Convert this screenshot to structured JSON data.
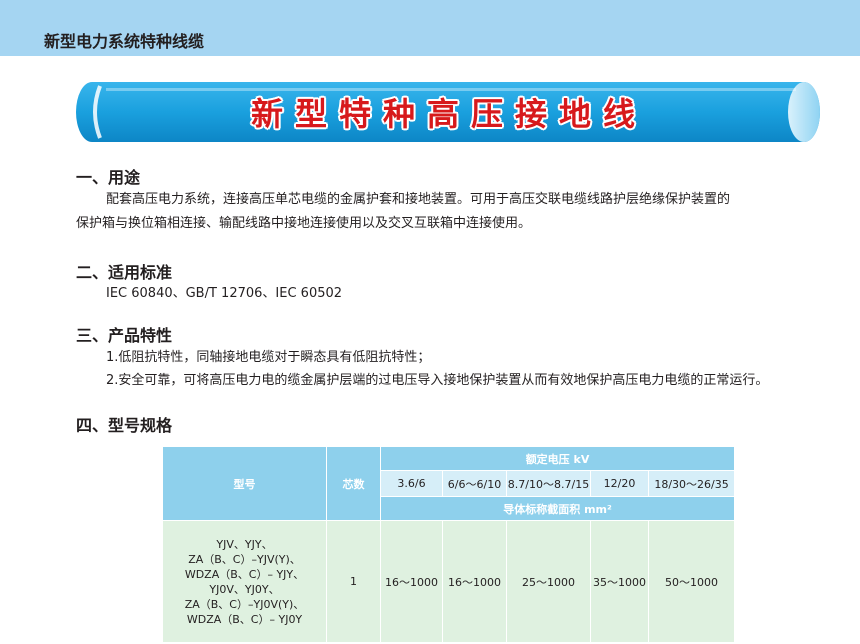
{
  "header": {
    "title": "新型电力系统特种线缆"
  },
  "banner": {
    "title": "新型特种高压接地线"
  },
  "sections": {
    "usage": {
      "heading": "一、用途",
      "line1": "配套高压电力系统，连接高压单芯电缆的金属护套和接地装置。可用于高压交联电缆线路护层绝缘保护装置的",
      "line2": "保护箱与换位箱相连接、输配线路中接地连接使用以及交叉互联箱中连接使用。"
    },
    "standards": {
      "heading": "二、适用标准",
      "text": "IEC 60840、GB/T 12706、IEC 60502"
    },
    "features": {
      "heading": "三、产品特性",
      "item1": "1.低阻抗特性，同轴接地电缆对于瞬态具有低阻抗特性；",
      "item2": "2.安全可靠，可将高压电力电的缆金属护层端的过电压导入接地保护装置从而有效地保护高压电力电缆的正常运行。"
    },
    "specs": {
      "heading": "四、型号规格"
    }
  },
  "table": {
    "col_model": "型号",
    "col_cores": "芯数",
    "voltage_header": "额定电压 kV",
    "voltages": [
      "3.6/6",
      "6/6～6/10",
      "8.7/10～8.7/15",
      "12/20",
      "18/30～26/35"
    ],
    "area_header": "导体标称截面积 mm²",
    "row": {
      "models": [
        "YJV、YJY、",
        "ZA（B、C）–YJV(Y)、",
        "WDZA（B、C）– YJY、",
        "YJ0V、YJ0Y、",
        "ZA（B、C）–YJ0V(Y)、",
        "WDZA（B、C）– YJ0Y"
      ],
      "cores": "1",
      "ranges": [
        "16～1000",
        "16～1000",
        "25～1000",
        "35～1000",
        "50～1000"
      ]
    }
  },
  "colors": {
    "topbar": "#a5d5f2",
    "banner_blue": "#1aa0de",
    "title_red": "#d7191c",
    "table_header": "#8ed0ec",
    "table_sub": "#d6eef8",
    "table_body": "#dff1e0"
  }
}
